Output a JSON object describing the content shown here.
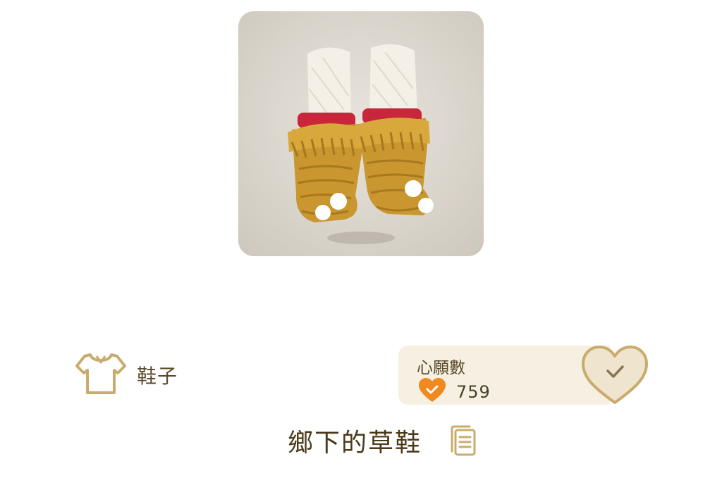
{
  "item": {
    "name": "鄉下的草鞋",
    "category": "鞋子",
    "image": "straw-boots-image"
  },
  "wishlist": {
    "title": "心願數",
    "count": "759"
  },
  "icons": {
    "category": "shirt-icon",
    "wish_count": "orange-heart-check-icon",
    "wish_button": "heart-check-icon",
    "details": "document-icon"
  },
  "colors": {
    "text_brown": "#5a4a2a",
    "accent_orange": "#f0891f",
    "heart_outline": "#c9ac6d",
    "panel_bg": "#f6f0e2"
  }
}
